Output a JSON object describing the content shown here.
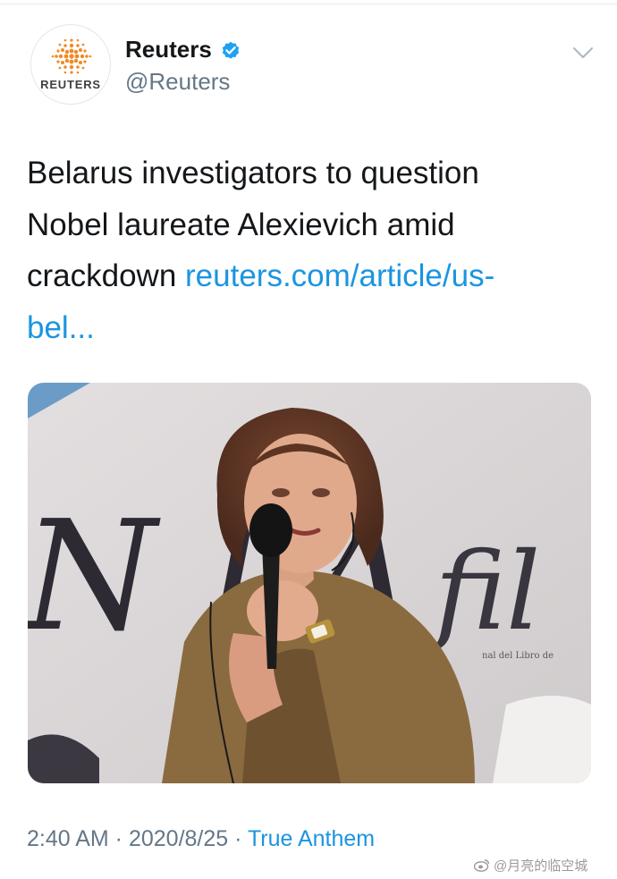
{
  "account": {
    "name": "Reuters",
    "handle": "@Reuters",
    "avatar_wordmark": "REUTERS",
    "verified": true
  },
  "tweet": {
    "text_line1": "Belarus investigators to question",
    "text_line2": "Nobel laureate Alexievich amid",
    "text_line3_plain": "crackdown ",
    "link_part1": "reuters.com/article/us-",
    "link_part2": "bel..."
  },
  "photo": {
    "backdrop_text": "N LA",
    "backdrop_text_2": "fil",
    "backdrop_small": "nal del Libro de"
  },
  "meta": {
    "time": "2:40 AM",
    "separator": " · ",
    "date": "2020/8/25",
    "source_app": "True Anthem"
  },
  "watermark": {
    "text": "@月亮的临空城"
  },
  "colors": {
    "link": "#1b95e0",
    "secondary_text": "#657786",
    "brand_orange": "#f08a24",
    "verified_blue": "#1da1f2"
  },
  "icons": [
    "reuters-logo-icon",
    "verified-badge-icon",
    "chevron-down-icon",
    "weibo-icon"
  ]
}
